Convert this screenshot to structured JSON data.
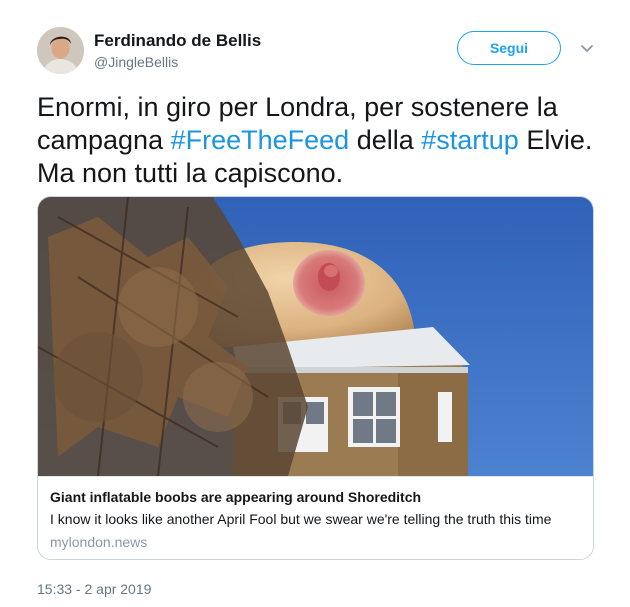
{
  "author": {
    "name": "Ferdinando de Bellis",
    "handle": "@JingleBellis",
    "avatar_icon": "user-avatar"
  },
  "follow_button": {
    "label": "Segui"
  },
  "menu_icon": "chevron-down-icon",
  "tweet": {
    "part1": "Enormi, in giro per Londra, per sostenere la campagna ",
    "hashtag1": "#FreeTheFeed",
    "part2": " della ",
    "hashtag2": "#startup",
    "part3": " Elvie. Ma non tutti la capiscono."
  },
  "card": {
    "image_description_icon": "photo-thumbnail",
    "title": "Giant inflatable boobs are appearing around Shoreditch",
    "description": "I know it looks like another April Fool but we swear we're telling the truth this time",
    "domain": "mylondon.news"
  },
  "timestamp": "15:33 - 2 apr 2019",
  "colors": {
    "link_blue": "#1b95e0",
    "button_blue": "#1da1f2",
    "secondary_text": "#657786",
    "border": "#ccd6dd"
  }
}
